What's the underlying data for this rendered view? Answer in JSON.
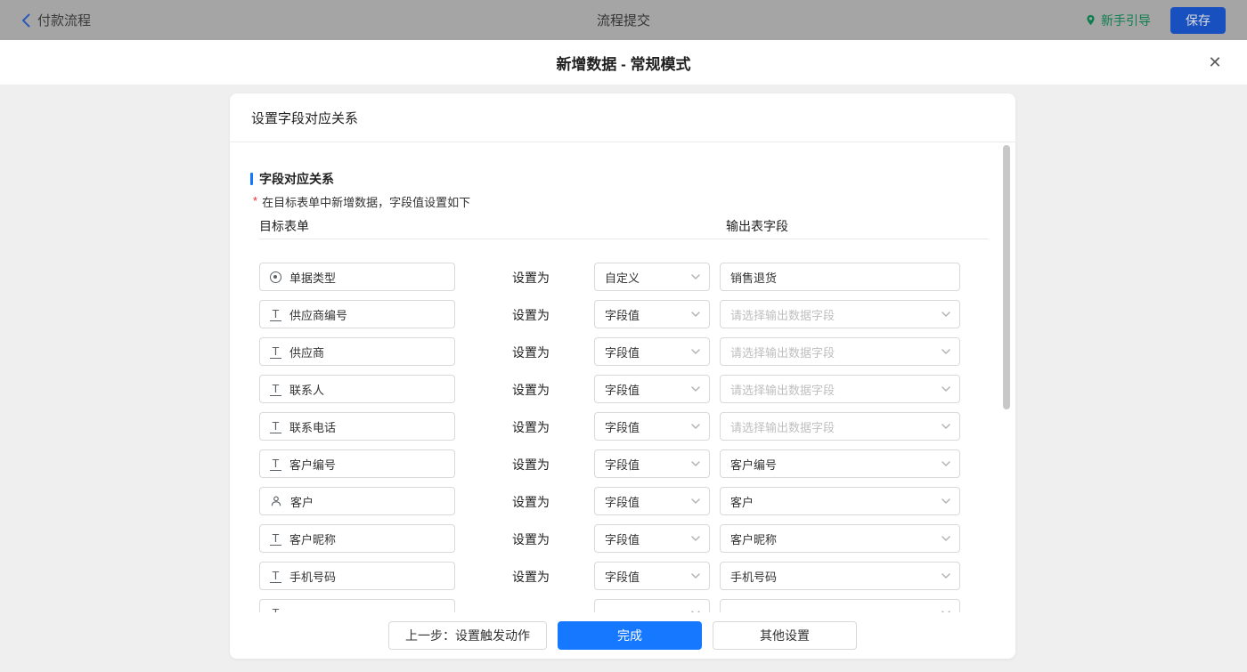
{
  "topbar": {
    "back_label": "付款流程",
    "title": "流程提交",
    "guide_label": "新手引导",
    "save_label": "保存"
  },
  "modal": {
    "title": "新增数据 - 常规模式",
    "close_glyph": "✕"
  },
  "panel": {
    "header": "设置字段对应关系",
    "section_title": "字段对应关系",
    "required_mark": "*",
    "section_note": "在目标表单中新增数据，字段值设置如下",
    "columns": {
      "left": "目标表单",
      "right": "输出表字段"
    },
    "set_as_label": "设置为",
    "rows": [
      {
        "icon": "radio-icon",
        "field": "单据类型",
        "mode": "自定义",
        "output": "销售退货",
        "output_kind": "input",
        "placeholder": false
      },
      {
        "icon": "text-icon",
        "field": "供应商编号",
        "mode": "字段值",
        "output": "请选择输出数据字段",
        "output_kind": "select",
        "placeholder": true
      },
      {
        "icon": "text-icon",
        "field": "供应商",
        "mode": "字段值",
        "output": "请选择输出数据字段",
        "output_kind": "select",
        "placeholder": true
      },
      {
        "icon": "text-icon",
        "field": "联系人",
        "mode": "字段值",
        "output": "请选择输出数据字段",
        "output_kind": "select",
        "placeholder": true
      },
      {
        "icon": "text-icon",
        "field": "联系电话",
        "mode": "字段值",
        "output": "请选择输出数据字段",
        "output_kind": "select",
        "placeholder": true
      },
      {
        "icon": "text-icon",
        "field": "客户编号",
        "mode": "字段值",
        "output": "客户编号",
        "output_kind": "select",
        "placeholder": false
      },
      {
        "icon": "user-icon",
        "field": "客户",
        "mode": "字段值",
        "output": "客户",
        "output_kind": "select",
        "placeholder": false
      },
      {
        "icon": "text-icon",
        "field": "客户昵称",
        "mode": "字段值",
        "output": "客户昵称",
        "output_kind": "select",
        "placeholder": false
      },
      {
        "icon": "text-icon",
        "field": "手机号码",
        "mode": "字段值",
        "output": "手机号码",
        "output_kind": "select",
        "placeholder": false
      },
      {
        "icon": "text-icon",
        "field": "",
        "mode": "",
        "output": "",
        "output_kind": "select",
        "placeholder": false
      }
    ],
    "footer": {
      "prev_label": "上一步：设置触发动作",
      "done_label": "完成",
      "other_label": "其他设置"
    }
  },
  "colors": {
    "primary_blue": "#1677ff",
    "guide_green": "#0e7d4f",
    "dimmed_save_blue": "#1950c0",
    "placeholder_gray": "#bfbfbf"
  }
}
